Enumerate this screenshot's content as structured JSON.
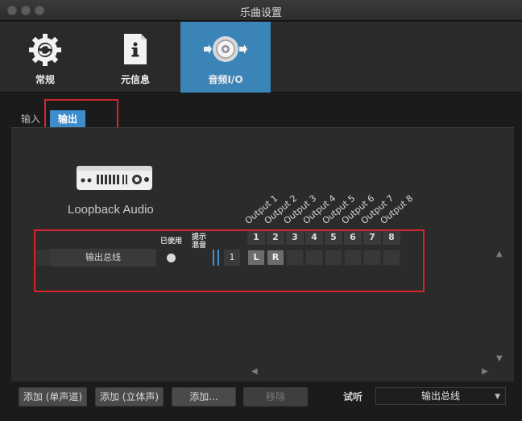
{
  "window": {
    "title": "乐曲设置"
  },
  "toolbar": {
    "items": [
      {
        "label": "常规",
        "icon": "gear-icon"
      },
      {
        "label": "元信息",
        "icon": "info-document-icon"
      },
      {
        "label": "音频I/O",
        "icon": "speaker-io-icon",
        "active": true
      }
    ]
  },
  "tabs": [
    {
      "label": "输入"
    },
    {
      "label": "输出",
      "active": true
    }
  ],
  "device": {
    "name": "Loopback Audio",
    "icon": "audio-interface-icon"
  },
  "columns": {
    "used": "已使用",
    "hint_line1": "提示",
    "hint_line2": "混音",
    "outputs": [
      "Output 1",
      "Output 2",
      "Output 3",
      "Output 4",
      "Output 5",
      "Output 6",
      "Output 7",
      "Output 8"
    ],
    "channel_numbers": [
      "1",
      "2",
      "3",
      "4",
      "5",
      "6",
      "7",
      "8"
    ]
  },
  "bus_row": {
    "name": "输出总线",
    "channel_count": "1",
    "left_label": "L",
    "right_label": "R"
  },
  "buttons": {
    "add_mono": "添加 (单声道)",
    "add_stereo": "添加 (立体声)",
    "add": "添加...",
    "remove": "移除"
  },
  "audition": {
    "label": "试听",
    "value": "输出总线"
  },
  "accent_color": "#3b84b8",
  "highlight_color": "#d6262d"
}
